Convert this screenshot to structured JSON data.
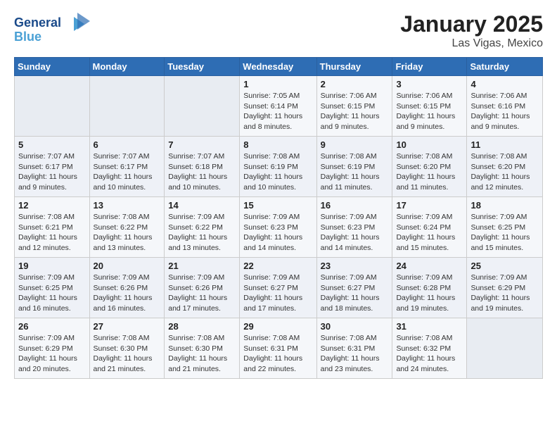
{
  "logo": {
    "line1": "General",
    "line2": "Blue"
  },
  "title": "January 2025",
  "subtitle": "Las Vigas, Mexico",
  "weekdays": [
    "Sunday",
    "Monday",
    "Tuesday",
    "Wednesday",
    "Thursday",
    "Friday",
    "Saturday"
  ],
  "weeks": [
    [
      {
        "day": "",
        "info": ""
      },
      {
        "day": "",
        "info": ""
      },
      {
        "day": "",
        "info": ""
      },
      {
        "day": "1",
        "info": "Sunrise: 7:05 AM\nSunset: 6:14 PM\nDaylight: 11 hours\nand 8 minutes."
      },
      {
        "day": "2",
        "info": "Sunrise: 7:06 AM\nSunset: 6:15 PM\nDaylight: 11 hours\nand 9 minutes."
      },
      {
        "day": "3",
        "info": "Sunrise: 7:06 AM\nSunset: 6:15 PM\nDaylight: 11 hours\nand 9 minutes."
      },
      {
        "day": "4",
        "info": "Sunrise: 7:06 AM\nSunset: 6:16 PM\nDaylight: 11 hours\nand 9 minutes."
      }
    ],
    [
      {
        "day": "5",
        "info": "Sunrise: 7:07 AM\nSunset: 6:17 PM\nDaylight: 11 hours\nand 9 minutes."
      },
      {
        "day": "6",
        "info": "Sunrise: 7:07 AM\nSunset: 6:17 PM\nDaylight: 11 hours\nand 10 minutes."
      },
      {
        "day": "7",
        "info": "Sunrise: 7:07 AM\nSunset: 6:18 PM\nDaylight: 11 hours\nand 10 minutes."
      },
      {
        "day": "8",
        "info": "Sunrise: 7:08 AM\nSunset: 6:19 PM\nDaylight: 11 hours\nand 10 minutes."
      },
      {
        "day": "9",
        "info": "Sunrise: 7:08 AM\nSunset: 6:19 PM\nDaylight: 11 hours\nand 11 minutes."
      },
      {
        "day": "10",
        "info": "Sunrise: 7:08 AM\nSunset: 6:20 PM\nDaylight: 11 hours\nand 11 minutes."
      },
      {
        "day": "11",
        "info": "Sunrise: 7:08 AM\nSunset: 6:20 PM\nDaylight: 11 hours\nand 12 minutes."
      }
    ],
    [
      {
        "day": "12",
        "info": "Sunrise: 7:08 AM\nSunset: 6:21 PM\nDaylight: 11 hours\nand 12 minutes."
      },
      {
        "day": "13",
        "info": "Sunrise: 7:08 AM\nSunset: 6:22 PM\nDaylight: 11 hours\nand 13 minutes."
      },
      {
        "day": "14",
        "info": "Sunrise: 7:09 AM\nSunset: 6:22 PM\nDaylight: 11 hours\nand 13 minutes."
      },
      {
        "day": "15",
        "info": "Sunrise: 7:09 AM\nSunset: 6:23 PM\nDaylight: 11 hours\nand 14 minutes."
      },
      {
        "day": "16",
        "info": "Sunrise: 7:09 AM\nSunset: 6:23 PM\nDaylight: 11 hours\nand 14 minutes."
      },
      {
        "day": "17",
        "info": "Sunrise: 7:09 AM\nSunset: 6:24 PM\nDaylight: 11 hours\nand 15 minutes."
      },
      {
        "day": "18",
        "info": "Sunrise: 7:09 AM\nSunset: 6:25 PM\nDaylight: 11 hours\nand 15 minutes."
      }
    ],
    [
      {
        "day": "19",
        "info": "Sunrise: 7:09 AM\nSunset: 6:25 PM\nDaylight: 11 hours\nand 16 minutes."
      },
      {
        "day": "20",
        "info": "Sunrise: 7:09 AM\nSunset: 6:26 PM\nDaylight: 11 hours\nand 16 minutes."
      },
      {
        "day": "21",
        "info": "Sunrise: 7:09 AM\nSunset: 6:26 PM\nDaylight: 11 hours\nand 17 minutes."
      },
      {
        "day": "22",
        "info": "Sunrise: 7:09 AM\nSunset: 6:27 PM\nDaylight: 11 hours\nand 17 minutes."
      },
      {
        "day": "23",
        "info": "Sunrise: 7:09 AM\nSunset: 6:27 PM\nDaylight: 11 hours\nand 18 minutes."
      },
      {
        "day": "24",
        "info": "Sunrise: 7:09 AM\nSunset: 6:28 PM\nDaylight: 11 hours\nand 19 minutes."
      },
      {
        "day": "25",
        "info": "Sunrise: 7:09 AM\nSunset: 6:29 PM\nDaylight: 11 hours\nand 19 minutes."
      }
    ],
    [
      {
        "day": "26",
        "info": "Sunrise: 7:09 AM\nSunset: 6:29 PM\nDaylight: 11 hours\nand 20 minutes."
      },
      {
        "day": "27",
        "info": "Sunrise: 7:08 AM\nSunset: 6:30 PM\nDaylight: 11 hours\nand 21 minutes."
      },
      {
        "day": "28",
        "info": "Sunrise: 7:08 AM\nSunset: 6:30 PM\nDaylight: 11 hours\nand 21 minutes."
      },
      {
        "day": "29",
        "info": "Sunrise: 7:08 AM\nSunset: 6:31 PM\nDaylight: 11 hours\nand 22 minutes."
      },
      {
        "day": "30",
        "info": "Sunrise: 7:08 AM\nSunset: 6:31 PM\nDaylight: 11 hours\nand 23 minutes."
      },
      {
        "day": "31",
        "info": "Sunrise: 7:08 AM\nSunset: 6:32 PM\nDaylight: 11 hours\nand 24 minutes."
      },
      {
        "day": "",
        "info": ""
      }
    ]
  ]
}
